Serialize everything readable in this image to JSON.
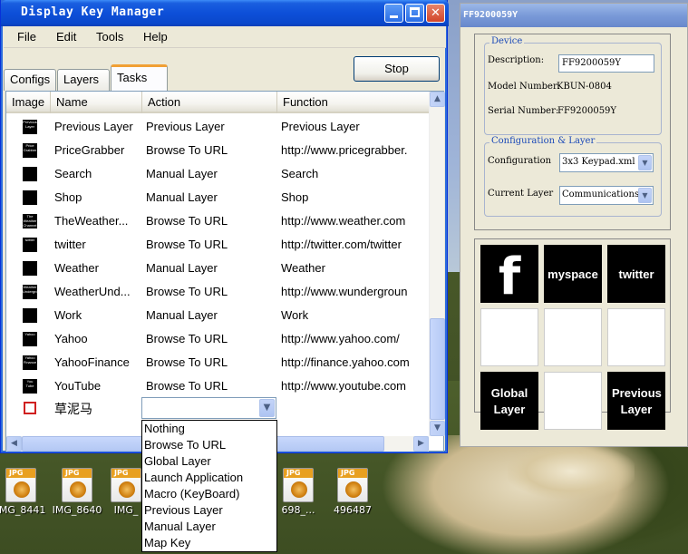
{
  "main_window": {
    "title": "Display Key Manager",
    "menu": [
      "File",
      "Edit",
      "Tools",
      "Help"
    ],
    "tabs": [
      {
        "label": "Configs",
        "active": false
      },
      {
        "label": "Layers",
        "active": false
      },
      {
        "label": "Tasks",
        "active": true
      }
    ],
    "stop_label": "Stop",
    "columns": [
      "Image",
      "Name",
      "Action",
      "Function"
    ],
    "rows": [
      {
        "icon": "previous-layer-icon",
        "icon_text": "Previous Layer",
        "name": "Previous Layer",
        "action": "Previous Layer",
        "function": "Previous Layer"
      },
      {
        "icon": "pricegrabber-icon",
        "icon_text": "Price Grabber",
        "name": "PriceGrabber",
        "action": "Browse To URL",
        "function": "http://www.pricegrabber."
      },
      {
        "icon": "search-icon",
        "icon_text": "",
        "name": "Search",
        "action": "Manual Layer",
        "function": "Search"
      },
      {
        "icon": "shop-icon",
        "icon_text": "",
        "name": "Shop",
        "action": "Manual Layer",
        "function": "Shop"
      },
      {
        "icon": "weather-channel-icon",
        "icon_text": "The Weather Channel",
        "name": "TheWeather...",
        "action": "Browse To URL",
        "function": "http://www.weather.com"
      },
      {
        "icon": "twitter-icon",
        "icon_text": "twitter",
        "name": "twitter",
        "action": "Browse To URL",
        "function": "http://twitter.com/twitter"
      },
      {
        "icon": "weather-icon",
        "icon_text": "",
        "name": "Weather",
        "action": "Manual Layer",
        "function": "Weather"
      },
      {
        "icon": "weather-underground-icon",
        "icon_text": "Weather Underground",
        "name": "WeatherUnd...",
        "action": "Browse To URL",
        "function": "http://www.wundergroun"
      },
      {
        "icon": "work-icon",
        "icon_text": "",
        "name": "Work",
        "action": "Manual Layer",
        "function": "Work"
      },
      {
        "icon": "yahoo-icon",
        "icon_text": "Yahoo",
        "name": "Yahoo",
        "action": "Browse To URL",
        "function": "http://www.yahoo.com/"
      },
      {
        "icon": "yahoo-finance-icon",
        "icon_text": "Yahoo Finance",
        "name": "YahooFinance",
        "action": "Browse To URL",
        "function": "http://finance.yahoo.com"
      },
      {
        "icon": "youtube-icon",
        "icon_text": "You Tube",
        "name": "YouTube",
        "action": "Browse To URL",
        "function": "http://www.youtube.com"
      }
    ],
    "new_row": {
      "icon": "blank-key-icon",
      "name": "草泥马",
      "action": ""
    },
    "action_options": [
      "Nothing",
      "Browse To URL",
      "Global Layer",
      "Launch Application",
      "Macro (KeyBoard)",
      "Previous Layer",
      "Manual Layer",
      "Map Key"
    ]
  },
  "device_window": {
    "title": "FF9200059Y",
    "device_group": {
      "legend": "Device",
      "description_label": "Description:",
      "description_value": "FF9200059Y",
      "model_label": "Model Number:",
      "model_value": "KBUN-0804",
      "serial_label": "Serial Number:",
      "serial_value": "FF9200059Y"
    },
    "config_group": {
      "legend": "Configuration & Layer",
      "configuration_label": "Configuration",
      "configuration_value": "3x3 Keypad.xml",
      "layer_label": "Current Layer",
      "layer_value": "Communications"
    },
    "keys": [
      {
        "label": "f",
        "style": "black",
        "kind": "facebook"
      },
      {
        "label": "myspace",
        "style": "black",
        "kind": "text"
      },
      {
        "label": "twitter",
        "style": "black",
        "kind": "text"
      },
      {
        "label": "",
        "style": "white",
        "kind": "blank"
      },
      {
        "label": "",
        "style": "white",
        "kind": "blank"
      },
      {
        "label": "",
        "style": "white",
        "kind": "blank"
      },
      {
        "label": "Global Layer",
        "style": "black",
        "kind": "text2"
      },
      {
        "label": "",
        "style": "white",
        "kind": "blank"
      },
      {
        "label": "Previous Layer",
        "style": "black",
        "kind": "text2"
      }
    ]
  },
  "desktop_icons": [
    {
      "label": "IMG_8441",
      "badge": "JPG"
    },
    {
      "label": "IMG_8640",
      "badge": "JPG"
    },
    {
      "label": "IMG_",
      "badge": "JPG"
    },
    {
      "label": "698_...",
      "badge": "JPG"
    },
    {
      "label": "496487",
      "badge": "JPG"
    }
  ]
}
